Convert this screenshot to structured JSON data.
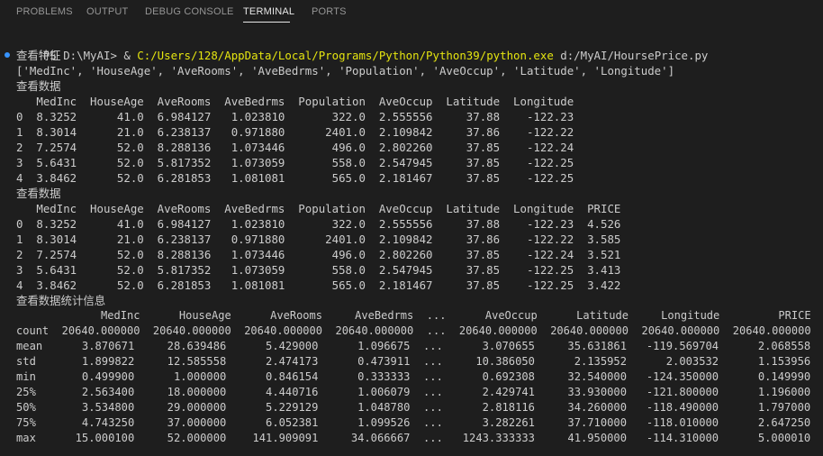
{
  "panel": {
    "tabs": [
      {
        "label": "PROBLEMS",
        "active": false
      },
      {
        "label": "OUTPUT",
        "active": false
      },
      {
        "label": "DEBUG CONSOLE",
        "active": false
      },
      {
        "label": "TERMINAL",
        "active": true
      },
      {
        "label": "PORTS",
        "active": false
      }
    ]
  },
  "terminal": {
    "prompt": "PS D:\\MyAI> & ",
    "command_path": "C:/Users/128/AppData/Local/Programs/Python/Python39/python.exe",
    "command_arg": " d:/MyAI/HoursePrice.py",
    "lines": [
      "查看特征",
      "['MedInc', 'HouseAge', 'AveRooms', 'AveBedrms', 'Population', 'AveOccup', 'Latitude', 'Longitude']",
      "查看数据",
      "   MedInc  HouseAge  AveRooms  AveBedrms  Population  AveOccup  Latitude  Longitude",
      "0  8.3252      41.0  6.984127   1.023810       322.0  2.555556     37.88    -122.23",
      "1  8.3014      21.0  6.238137   0.971880      2401.0  2.109842     37.86    -122.22",
      "2  7.2574      52.0  8.288136   1.073446       496.0  2.802260     37.85    -122.24",
      "3  5.6431      52.0  5.817352   1.073059       558.0  2.547945     37.85    -122.25",
      "4  3.8462      52.0  6.281853   1.081081       565.0  2.181467     37.85    -122.25",
      "查看数据",
      "   MedInc  HouseAge  AveRooms  AveBedrms  Population  AveOccup  Latitude  Longitude  PRICE",
      "0  8.3252      41.0  6.984127   1.023810       322.0  2.555556     37.88    -122.23  4.526",
      "1  8.3014      21.0  6.238137   0.971880      2401.0  2.109842     37.86    -122.22  3.585",
      "2  7.2574      52.0  8.288136   1.073446       496.0  2.802260     37.85    -122.24  3.521",
      "3  5.6431      52.0  5.817352   1.073059       558.0  2.547945     37.85    -122.25  3.413",
      "4  3.8462      52.0  6.281853   1.081081       565.0  2.181467     37.85    -122.25  3.422",
      "查看数据统计信息",
      "             MedInc      HouseAge      AveRooms     AveBedrms  ...      AveOccup      Latitude     Longitude         PRICE",
      "count  20640.000000  20640.000000  20640.000000  20640.000000  ...  20640.000000  20640.000000  20640.000000  20640.000000",
      "mean      3.870671     28.639486      5.429000      1.096675  ...      3.070655     35.631861   -119.569704      2.068558",
      "std       1.899822     12.585558      2.474173      0.473911  ...     10.386050      2.135952      2.003532      1.153956",
      "min       0.499900      1.000000      0.846154      0.333333  ...      0.692308     32.540000   -124.350000      0.149990",
      "25%       2.563400     18.000000      4.440716      1.006079  ...      2.429741     33.930000   -121.800000      1.196000",
      "50%       3.534800     29.000000      5.229129      1.048780  ...      2.818116     34.260000   -118.490000      1.797000",
      "75%       4.743250     37.000000      6.052381      1.099526  ...      3.282261     37.710000   -118.010000      2.647250",
      "max      15.000100     52.000000    141.909091     34.066667  ...   1243.333333     41.950000   -114.310000      5.000010"
    ],
    "colors": {
      "background": "#1e1e1e",
      "text": "#cccccc",
      "command": "#e5e510",
      "marker": "#3794ff"
    }
  }
}
